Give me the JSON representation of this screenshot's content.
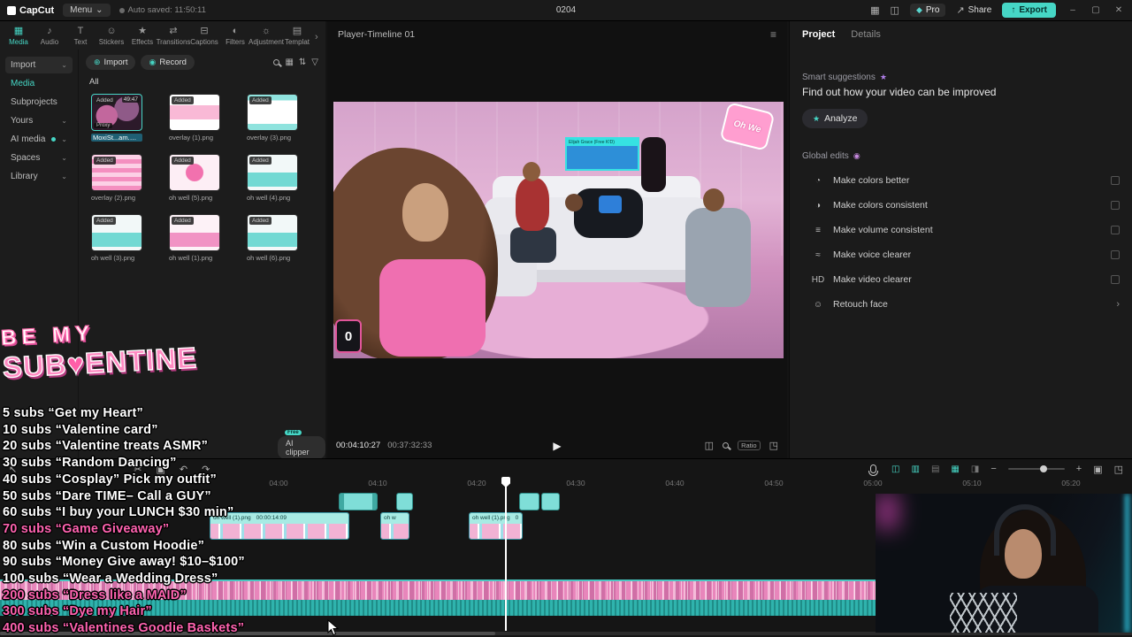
{
  "icons": {
    "caret_down": "⌄",
    "layout": "▦",
    "panels": "◫",
    "gem": "◆",
    "share": "↗",
    "export": "↑",
    "minimize": "–",
    "maximize": "▢",
    "close": "✕",
    "overflow": "›",
    "import_plus": "⊕",
    "record_dot": "◉",
    "grid": "▦",
    "list": "≡",
    "sort": "⇅",
    "filter": "▽",
    "hamburger": "≡",
    "play": "▶",
    "split_screen": "◫",
    "fit": "▣",
    "fullscreen": "◳",
    "select_tool": "↖",
    "split_tool": "✂",
    "copy_tool": "▣",
    "undo": "↶",
    "redo": "↷",
    "tgl_a": "◫",
    "tgl_b": "▥",
    "tgl_c": "▤",
    "tgl_d": "▦",
    "tgl_e": "◨",
    "zoom_out": "−",
    "zoom_in": "+",
    "sparkle": "★",
    "eyes": "◉"
  },
  "topbar": {
    "logo": "CapCut",
    "menu": "Menu",
    "autosave": "Auto saved: 11:50:11",
    "center_label": "0204",
    "pro": "Pro",
    "share": "Share",
    "export": "Export"
  },
  "ribbon": {
    "tabs": [
      {
        "icon": "▦",
        "label": "Media",
        "state": "active"
      },
      {
        "icon": "♪",
        "label": "Audio"
      },
      {
        "icon": "T",
        "label": "Text"
      },
      {
        "icon": "☺",
        "label": "Stickers"
      },
      {
        "icon": "★",
        "label": "Effects"
      },
      {
        "icon": "⇄",
        "label": "Transitions"
      },
      {
        "icon": "⊟",
        "label": "Captions"
      },
      {
        "icon": "◐",
        "label": "Filters"
      },
      {
        "icon": "☼",
        "label": "Adjustment"
      },
      {
        "icon": "▤",
        "label": "Templat"
      }
    ]
  },
  "sidebar": {
    "items": [
      {
        "label": "Import",
        "caret": "⌄",
        "state": "boxed"
      },
      {
        "label": "Media",
        "state": "active"
      },
      {
        "label": "Subprojects"
      },
      {
        "label": "Yours",
        "caret": "⌄"
      },
      {
        "label": "AI media",
        "caret": "⌄",
        "dot": true
      },
      {
        "label": "Spaces",
        "caret": "⌄"
      },
      {
        "label": "Library",
        "caret": "⌄"
      }
    ]
  },
  "media": {
    "import": "Import",
    "record": "Record",
    "all": "All",
    "ai_clipper": "AI clipper",
    "free": "Free",
    "items": [
      {
        "name": "MoxiSt...am.mp4",
        "badge": "Added",
        "duration": "49:47",
        "proxy": "Proxy",
        "art": "video",
        "state": "selected"
      },
      {
        "name": "overlay (1).png",
        "badge": "Added",
        "art": "overlay-pink"
      },
      {
        "name": "overlay (3).png",
        "badge": "Added",
        "art": "overlay-cyan"
      },
      {
        "name": "overlay (2).png",
        "badge": "Added",
        "art": "stripes-pink"
      },
      {
        "name": "oh well (5).png",
        "badge": "Added",
        "art": "bow"
      },
      {
        "name": "oh well (4).png",
        "badge": "Added",
        "art": "chat-cyan"
      },
      {
        "name": "oh well (3).png",
        "badge": "Added",
        "art": "chat-cyan"
      },
      {
        "name": "oh well (1).png",
        "badge": "Added",
        "art": "chat-pink"
      },
      {
        "name": "oh well (6).png",
        "badge": "Added",
        "art": "chat-cyan"
      }
    ]
  },
  "preview": {
    "title": "Player-Timeline 01",
    "current": "00:04:10:27",
    "total": "00:37:32:33",
    "ratio": "Ratio",
    "nameplate": "Elijah Grace (Free K!D)",
    "phone": "Oh We",
    "badge": "0"
  },
  "panel": {
    "tabs": [
      {
        "label": "Project",
        "state": "active"
      },
      {
        "label": "Details"
      }
    ],
    "smart_title": "Smart suggestions",
    "smart_desc": "Find out how your video can be improved",
    "analyze": "Analyze",
    "global_title": "Global edits",
    "edits": [
      {
        "icon": "◔",
        "label": "Make colors better",
        "trail": "box",
        "trail_glyph": ""
      },
      {
        "icon": "◑",
        "label": "Make colors consistent",
        "trail": "box",
        "trail_glyph": ""
      },
      {
        "icon": "≡",
        "label": "Make volume consistent",
        "trail": "box",
        "trail_glyph": ""
      },
      {
        "icon": "≈",
        "label": "Make voice clearer",
        "trail": "box",
        "trail_glyph": ""
      },
      {
        "icon": "HD",
        "label": "Make video clearer",
        "trail": "box",
        "trail_glyph": ""
      },
      {
        "icon": "☺",
        "label": "Retouch face",
        "trail": "chev",
        "trail_glyph": "›"
      }
    ]
  },
  "timeline": {
    "ruler": [
      "04:00",
      "04:10",
      "04:20",
      "04:30",
      "04:40",
      "04:50",
      "05:00",
      "05:10",
      "05:20"
    ],
    "clips": [
      {
        "label": "oh well (1).png",
        "time": "00:00:14:09"
      },
      {
        "label": "oh w"
      },
      {
        "label": "oh well (1).png",
        "time": "0"
      }
    ]
  },
  "banner": {
    "be": "BE",
    "my": "MY",
    "sub": "SUB",
    "heart": "♥",
    "entine": "ENTINE"
  },
  "goals": [
    {
      "count": "5 subs",
      "text": "“Get my Heart”"
    },
    {
      "count": "10 subs",
      "text": "“Valentine card”"
    },
    {
      "count": "20 subs",
      "text": "“Valentine treats ASMR”"
    },
    {
      "count": "30 subs",
      "text": "“Random Dancing”"
    },
    {
      "count": "40 subs",
      "text": "“Cosplay” Pick my outfit”"
    },
    {
      "count": "50 subs",
      "text": "“Dare TIME– Call a GUY”"
    },
    {
      "count": "60 subs",
      "text": "“I buy your LUNCH $30 min”"
    },
    {
      "count": "70 subs",
      "text": "“Game Giveaway”",
      "tone": "pink"
    },
    {
      "count": "80 subs",
      "text": "“Win a Custom Hoodie”"
    },
    {
      "count": "90 subs",
      "text": "“Money Give away! $10–$100”"
    },
    {
      "count": "100 subs",
      "text": "“Wear a Wedding Dress”"
    },
    {
      "count": "200 subs",
      "text": "“Dress like a MAID”",
      "tone": "pink"
    },
    {
      "count": "300 subs",
      "text": "“Dye my Hair”",
      "tone": "pink"
    },
    {
      "count": "400 subs",
      "text": "“Valentines Goodie Baskets”",
      "tone": "pink"
    }
  ]
}
